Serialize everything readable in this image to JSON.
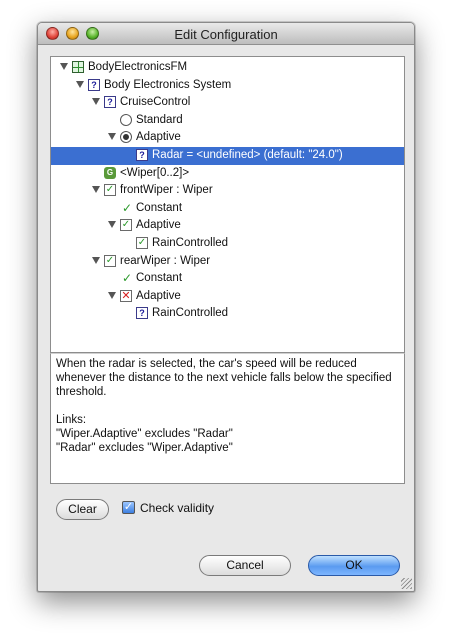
{
  "window": {
    "title": "Edit Configuration"
  },
  "tree": {
    "rows": [
      {
        "label": "BodyElectronicsFM",
        "icon": "feature-model-icon"
      },
      {
        "label": "Body Electronics System",
        "icon": "undecided-feature-icon"
      },
      {
        "label": "CruiseControl",
        "icon": "undecided-feature-icon"
      },
      {
        "label": "Standard",
        "icon": "radio-icon"
      },
      {
        "label": "Adaptive",
        "icon": "radio-selected-icon"
      },
      {
        "label": "Radar = <undefined> (default: \"24.0\")",
        "icon": "undecided-feature-icon"
      },
      {
        "label": "<Wiper[0..2]>",
        "icon": "feature-group-icon"
      },
      {
        "label": "frontWiper : Wiper",
        "icon": "checkbox-checked-icon"
      },
      {
        "label": "Constant",
        "icon": "checkmark-icon"
      },
      {
        "label": "Adaptive",
        "icon": "checkbox-checked-icon"
      },
      {
        "label": "RainControlled",
        "icon": "checkbox-checked-icon"
      },
      {
        "label": "rearWiper : Wiper",
        "icon": "checkbox-checked-icon"
      },
      {
        "label": "Constant",
        "icon": "checkmark-icon"
      },
      {
        "label": "Adaptive",
        "icon": "checkbox-excluded-icon"
      },
      {
        "label": "RainControlled",
        "icon": "undecided-feature-icon"
      }
    ]
  },
  "description": {
    "text": "When the radar is selected, the car's speed will be reduced whenever the distance to the next vehicle falls below the specified threshold.",
    "links_heading": "Links:",
    "link_1": "\"Wiper.Adaptive\"  excludes  \"Radar\"",
    "link_2": "\"Radar\"  excludes  \"Wiper.Adaptive\""
  },
  "controls": {
    "clear_label": "Clear",
    "check_validity_label": "Check validity",
    "check_validity_checked": true,
    "cancel_label": "Cancel",
    "ok_label": "OK"
  },
  "colors": {
    "selection": "#3b6fd1",
    "ok_button": "#5b9bf0",
    "check_green": "#2a9a2a",
    "excluded_red": "#d62020"
  }
}
